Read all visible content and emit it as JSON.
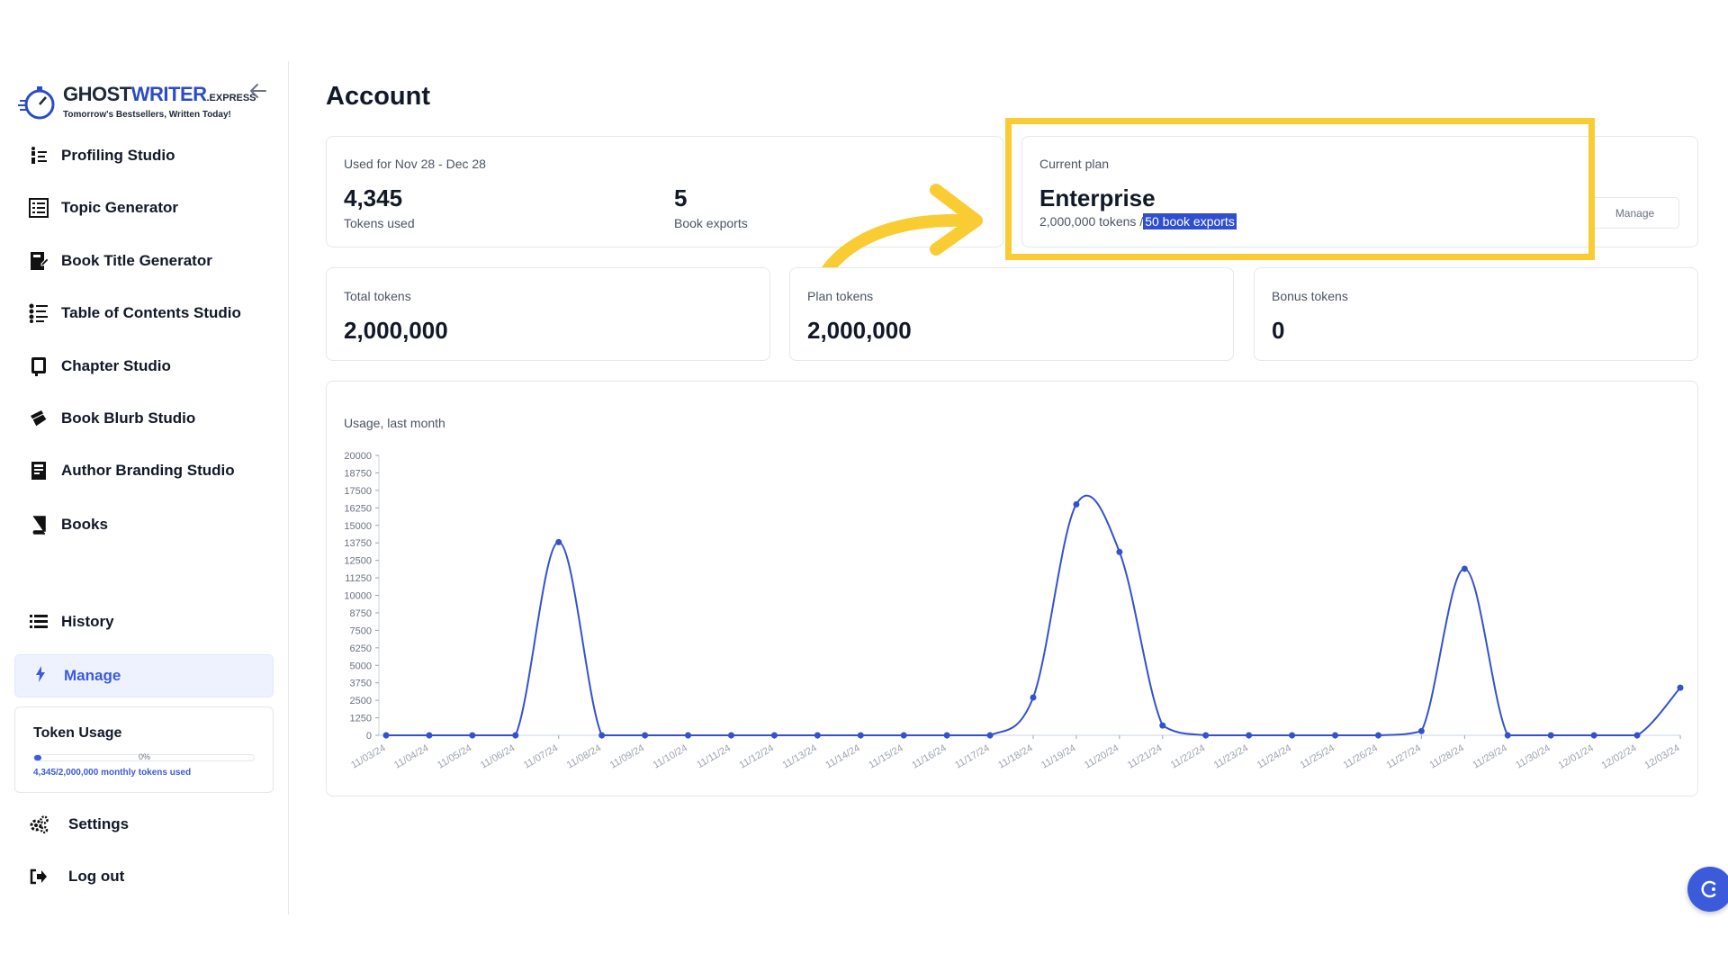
{
  "brand": {
    "name_part1": "GHOST",
    "name_part2": "WRITER",
    "name_part3": ".EXPRESS",
    "tagline": "Tomorrow's Bestsellers, Written Today!"
  },
  "sidebar": {
    "items": [
      {
        "label": "Profiling Studio",
        "icon": "profiling-icon"
      },
      {
        "label": "Topic Generator",
        "icon": "topic-icon"
      },
      {
        "label": "Book Title Generator",
        "icon": "book-title-icon"
      },
      {
        "label": "Table of Contents Studio",
        "icon": "toc-icon"
      },
      {
        "label": "Chapter Studio",
        "icon": "chapter-icon"
      },
      {
        "label": "Book Blurb Studio",
        "icon": "blurb-icon"
      },
      {
        "label": "Author Branding Studio",
        "icon": "branding-icon"
      },
      {
        "label": "Books",
        "icon": "books-icon"
      }
    ],
    "history": "History",
    "manage": "Manage",
    "settings": "Settings",
    "logout": "Log out",
    "token_usage": {
      "title": "Token Usage",
      "percent_label": "0%",
      "fraction": 0.0022,
      "text": "4,345/2,000,000 monthly tokens used"
    }
  },
  "main": {
    "title": "Account",
    "usage": {
      "period": "Used for Nov 28 - Dec 28",
      "tokens_value": "4,345",
      "tokens_label": "Tokens used",
      "exports_value": "5",
      "exports_label": "Book exports"
    },
    "plan": {
      "label": "Current plan",
      "name": "Enterprise",
      "tokens": "2,000,000 tokens",
      "separator": "/",
      "exports": "50 book exports",
      "manage": "Manage"
    },
    "totals": {
      "total_label": "Total tokens",
      "total_value": "2,000,000",
      "plan_label": "Plan tokens",
      "plan_value": "2,000,000",
      "bonus_label": "Bonus tokens",
      "bonus_value": "0"
    },
    "chart_title": "Usage, last month"
  },
  "colors": {
    "accent": "#3b5bdb",
    "highlight": "#facc34",
    "line": "#3452cf"
  },
  "chart_data": {
    "type": "line",
    "title": "Usage, last month",
    "categories": [
      "11/03/24",
      "11/04/24",
      "11/05/24",
      "11/06/24",
      "11/07/24",
      "11/08/24",
      "11/09/24",
      "11/10/24",
      "11/11/24",
      "11/12/24",
      "11/13/24",
      "11/14/24",
      "11/15/24",
      "11/16/24",
      "11/17/24",
      "11/18/24",
      "11/19/24",
      "11/20/24",
      "11/21/24",
      "11/22/24",
      "11/23/24",
      "11/24/24",
      "11/25/24",
      "11/26/24",
      "11/27/24",
      "11/28/24",
      "11/29/24",
      "11/30/24",
      "12/01/24",
      "12/02/24",
      "12/03/24"
    ],
    "values": [
      0,
      0,
      0,
      0,
      13800,
      0,
      0,
      0,
      0,
      0,
      0,
      0,
      0,
      0,
      0,
      2700,
      16500,
      13100,
      700,
      0,
      0,
      0,
      0,
      0,
      300,
      11900,
      0,
      0,
      0,
      0,
      3400
    ],
    "yticks": [
      0,
      1250,
      2500,
      3750,
      5000,
      6250,
      7500,
      8750,
      10000,
      11250,
      12500,
      13750,
      15000,
      16250,
      17500,
      18750,
      20000
    ],
    "ylim": [
      0,
      20000
    ],
    "grid": false,
    "legend": "none"
  }
}
